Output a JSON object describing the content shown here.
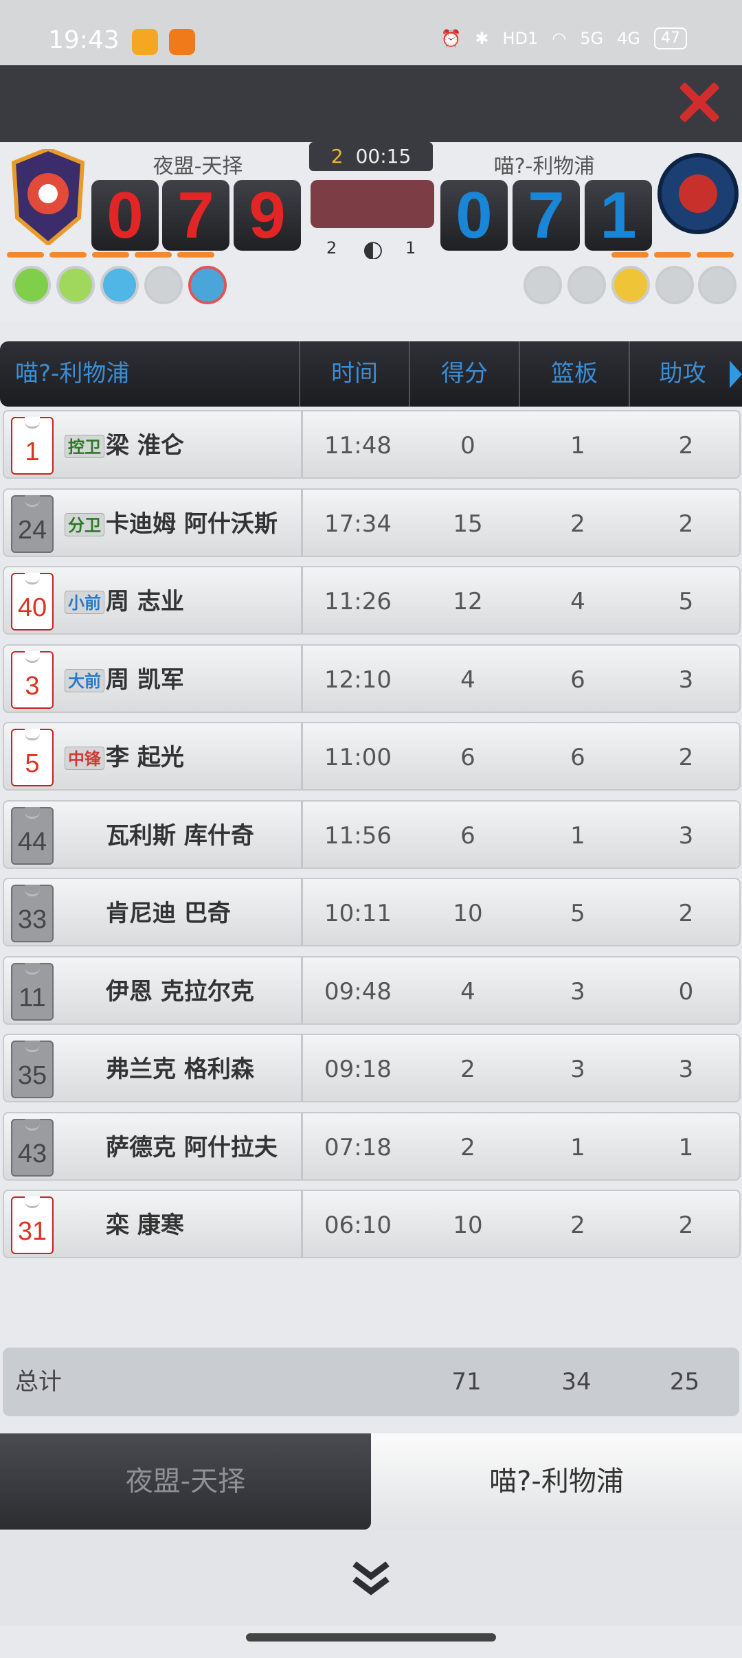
{
  "status_bar": {
    "time": "19:43",
    "network_5g": "5G",
    "network_4g": "4G",
    "hd_label": "HD1",
    "battery": "47"
  },
  "scoreboard": {
    "home_name": "夜盟-天择",
    "away_name": "喵?-利物浦",
    "home_score_digits": [
      "0",
      "7",
      "9"
    ],
    "away_score_digits": [
      "0",
      "7",
      "1"
    ],
    "quarter": "2",
    "clock": "00:15",
    "home_timeouts": "2",
    "away_timeouts": "1"
  },
  "table": {
    "team_label": "喵?-利物浦",
    "columns": [
      "时间",
      "得分",
      "篮板",
      "助攻"
    ],
    "players": [
      {
        "number": "1",
        "starter": true,
        "position": "控卫",
        "pos_color": "#2a7a22",
        "name": "梁 淮仑",
        "time": "11:48",
        "pts": "0",
        "reb": "1",
        "ast": "2"
      },
      {
        "number": "24",
        "starter": false,
        "position": "分卫",
        "pos_color": "#2a7a22",
        "name": "卡迪姆 阿什沃斯",
        "time": "17:34",
        "pts": "15",
        "reb": "2",
        "ast": "2"
      },
      {
        "number": "40",
        "starter": true,
        "position": "小前",
        "pos_color": "#2a79c9",
        "name": "周 志业",
        "time": "11:26",
        "pts": "12",
        "reb": "4",
        "ast": "5"
      },
      {
        "number": "3",
        "starter": true,
        "position": "大前",
        "pos_color": "#2a79c9",
        "name": "周 凯军",
        "time": "12:10",
        "pts": "4",
        "reb": "6",
        "ast": "3"
      },
      {
        "number": "5",
        "starter": true,
        "position": "中锋",
        "pos_color": "#d23b35",
        "name": "李 起光",
        "time": "11:00",
        "pts": "6",
        "reb": "6",
        "ast": "2"
      },
      {
        "number": "44",
        "starter": false,
        "position": "",
        "pos_color": "",
        "name": "瓦利斯 库什奇",
        "time": "11:56",
        "pts": "6",
        "reb": "1",
        "ast": "3"
      },
      {
        "number": "33",
        "starter": false,
        "position": "",
        "pos_color": "",
        "name": "肯尼迪 巴奇",
        "time": "10:11",
        "pts": "10",
        "reb": "5",
        "ast": "2"
      },
      {
        "number": "11",
        "starter": false,
        "position": "",
        "pos_color": "",
        "name": "伊恩 克拉尔克",
        "time": "09:48",
        "pts": "4",
        "reb": "3",
        "ast": "0"
      },
      {
        "number": "35",
        "starter": false,
        "position": "",
        "pos_color": "",
        "name": "弗兰克 格利森",
        "time": "09:18",
        "pts": "2",
        "reb": "3",
        "ast": "3"
      },
      {
        "number": "43",
        "starter": false,
        "position": "",
        "pos_color": "",
        "name": "萨德克 阿什拉夫",
        "time": "07:18",
        "pts": "2",
        "reb": "1",
        "ast": "1"
      },
      {
        "number": "31",
        "starter": true,
        "position": "",
        "pos_color": "",
        "name": "栾 康寒",
        "time": "06:10",
        "pts": "10",
        "reb": "2",
        "ast": "2"
      }
    ],
    "totals": {
      "label": "总计",
      "pts": "71",
      "reb": "34",
      "ast": "25"
    }
  },
  "tabs": {
    "home": "夜盟-天择",
    "away": "喵?-利物浦"
  },
  "icons": {
    "close": "close-icon",
    "collapse": "double-chevron-down-icon",
    "scroll_right": "triangle-right-icon"
  },
  "colors": {
    "accent_blue": "#3a8ed6",
    "home_red": "#e42525",
    "away_blue": "#1a86d8"
  }
}
